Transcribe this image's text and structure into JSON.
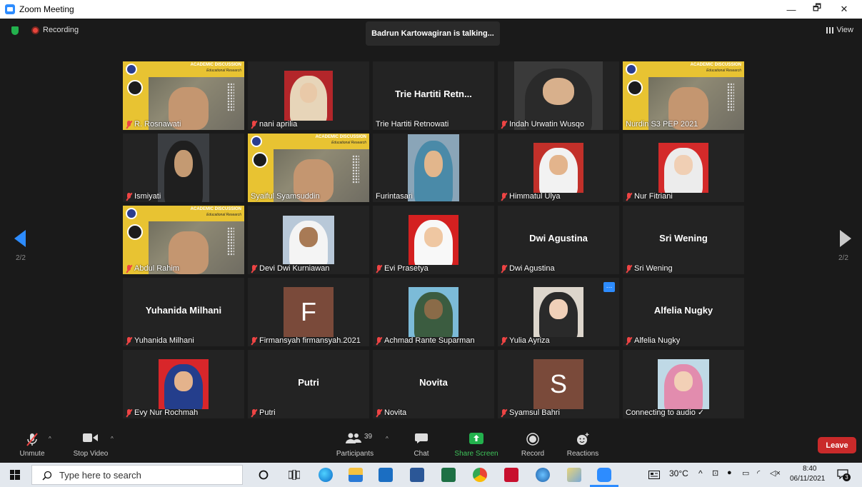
{
  "window": {
    "title": "Zoom Meeting",
    "minimize": "—",
    "maximize": "🗗",
    "close": "✕"
  },
  "topbar": {
    "recording": "Recording",
    "talking": "Badrun Kartowagiran is talking...",
    "view": "View"
  },
  "paging": {
    "left": "2/2",
    "right": "2/2"
  },
  "participants": [
    {
      "name": "R. Rosnawati",
      "muted": true,
      "kind": "poster"
    },
    {
      "name": "nani aprilia",
      "muted": true,
      "kind": "photo"
    },
    {
      "name": "Trie Hartiti Retnowati",
      "muted": false,
      "kind": "name",
      "big": "Trie Hartiti Retn..."
    },
    {
      "name": "Indah Urwatin Wusqo",
      "muted": true,
      "kind": "video"
    },
    {
      "name": "Nurdin S3 PEP 2021",
      "muted": false,
      "kind": "poster"
    },
    {
      "name": "Ismiyati",
      "muted": true,
      "kind": "video"
    },
    {
      "name": "Syaiful Syamsuddin",
      "muted": false,
      "kind": "poster"
    },
    {
      "name": "Furintasari",
      "muted": false,
      "kind": "photo"
    },
    {
      "name": "Himmatul Ulya",
      "muted": true,
      "kind": "photo"
    },
    {
      "name": "Nur Fitriani",
      "muted": true,
      "kind": "photo"
    },
    {
      "name": "Abdul Rahim",
      "muted": true,
      "kind": "poster"
    },
    {
      "name": "Devi Dwi Kurniawan",
      "muted": true,
      "kind": "photo"
    },
    {
      "name": "Evi Prasetya",
      "muted": true,
      "kind": "photo"
    },
    {
      "name": "Dwi Agustina",
      "muted": true,
      "kind": "name",
      "big": "Dwi Agustina"
    },
    {
      "name": "Sri Wening",
      "muted": true,
      "kind": "name",
      "big": "Sri Wening"
    },
    {
      "name": "Yuhanida Milhani",
      "muted": true,
      "kind": "name",
      "big": "Yuhanida Milhani"
    },
    {
      "name": "Firmansyah firmansyah.2021",
      "muted": true,
      "kind": "letter",
      "letter": "F"
    },
    {
      "name": "Achmad Rante Suparman",
      "muted": true,
      "kind": "photo"
    },
    {
      "name": "Yulia Ayriza",
      "muted": true,
      "kind": "photo"
    },
    {
      "name": "Alfelia Nugky",
      "muted": true,
      "kind": "name",
      "big": "Alfelia Nugky"
    },
    {
      "name": "Evy Nur Rochmah",
      "muted": true,
      "kind": "photo"
    },
    {
      "name": "Putri",
      "muted": true,
      "kind": "name",
      "big": "Putri"
    },
    {
      "name": "Novita",
      "muted": true,
      "kind": "name",
      "big": "Novita"
    },
    {
      "name": "Syamsul Bahri",
      "muted": true,
      "kind": "letter",
      "letter": "S"
    },
    {
      "name": "Connecting to audio ✓",
      "muted": false,
      "kind": "photo"
    }
  ],
  "poster_text": {
    "heading": "ACADEMIC DISCUSSION",
    "sub": "Educational Research"
  },
  "toolbar": {
    "unmute": "Unmute",
    "stop_video": "Stop Video",
    "participants": "Participants",
    "participant_count": "39",
    "chat": "Chat",
    "share_screen": "Share Screen",
    "record": "Record",
    "reactions": "Reactions",
    "leave": "Leave"
  },
  "taskbar": {
    "search_placeholder": "Type here to search",
    "weather": "30°C",
    "time": "8:40",
    "date": "06/11/2021",
    "notifications": "3"
  },
  "colors": {
    "accent": "#2d8cff",
    "leave": "#c92a2a",
    "share": "#23b14d",
    "mute": "#e44444"
  }
}
